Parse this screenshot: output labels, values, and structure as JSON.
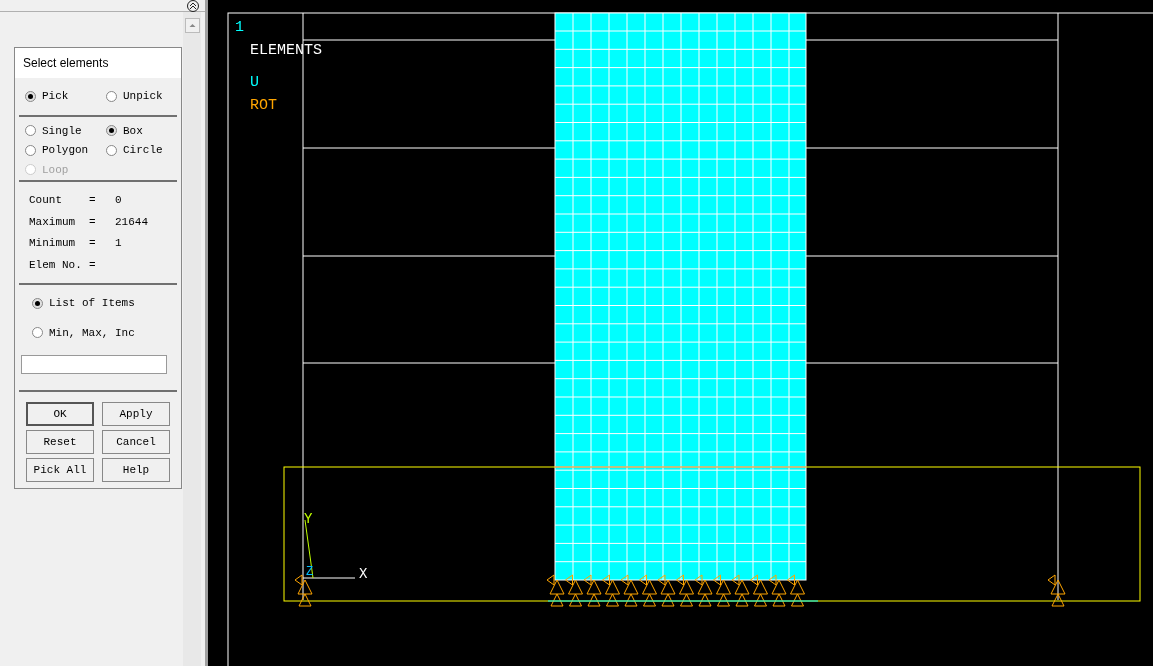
{
  "dialog": {
    "title": "Select elements",
    "mode_options": [
      {
        "label": "Pick",
        "selected": true
      },
      {
        "label": "Unpick",
        "selected": false
      }
    ],
    "shape_options": [
      {
        "label": "Single",
        "selected": false,
        "disabled": false
      },
      {
        "label": "Box",
        "selected": true,
        "disabled": false
      },
      {
        "label": "Polygon",
        "selected": false,
        "disabled": false
      },
      {
        "label": "Circle",
        "selected": false,
        "disabled": false
      },
      {
        "label": "Loop",
        "selected": false,
        "disabled": true
      }
    ],
    "stats": [
      {
        "label": "Count",
        "sign": "=",
        "value": "0"
      },
      {
        "label": "Maximum",
        "sign": "=",
        "value": "21644"
      },
      {
        "label": "Minimum",
        "sign": "=",
        "value": "1"
      },
      {
        "label": "Elem No.",
        "sign": "="
      }
    ],
    "list_options": [
      {
        "label": "List of Items",
        "selected": true
      },
      {
        "label": "Min, Max, Inc",
        "selected": false
      }
    ],
    "buttons": [
      {
        "label": "OK",
        "default": true
      },
      {
        "label": "Apply",
        "default": false
      },
      {
        "label": "Reset",
        "default": false
      },
      {
        "label": "Cancel",
        "default": false
      },
      {
        "label": "Pick All",
        "default": false
      },
      {
        "label": "Help",
        "default": false
      }
    ]
  },
  "graphics": {
    "window_number": "1",
    "legend": {
      "title": "ELEMENTS",
      "items": [
        {
          "label": "U",
          "color": "#00ffff"
        },
        {
          "label": "ROT",
          "color": "#ffa500"
        }
      ]
    },
    "triad": {
      "x": "X",
      "y": "Y",
      "z": "Z"
    }
  }
}
